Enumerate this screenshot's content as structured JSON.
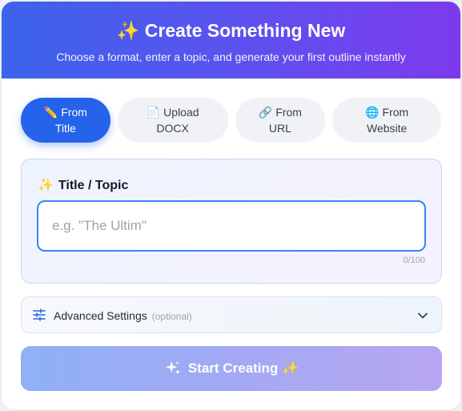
{
  "header": {
    "title": "✨ Create Something New",
    "subtitle": "Choose a format, enter a topic, and generate your first outline instantly"
  },
  "tabs": [
    {
      "icon": "✏️",
      "line1": "From",
      "line2": "Title",
      "active": true
    },
    {
      "icon": "📄",
      "line1": "Upload",
      "line2": "DOCX",
      "active": false
    },
    {
      "icon": "🔗",
      "line1": "From",
      "line2": "URL",
      "active": false
    },
    {
      "icon": "🌐",
      "line1": "From",
      "line2": "Website",
      "active": false
    }
  ],
  "topic": {
    "label_icon": "✨",
    "label": "Title / Topic",
    "placeholder": "e.g. \"The Ultim\"",
    "value": "",
    "counter": "0/100"
  },
  "advanced": {
    "label": "Advanced Settings",
    "optional_text": "(optional)",
    "icon": "sliders-icon",
    "expand_icon": "chevron-down-icon"
  },
  "cta": {
    "icon": "sparkles-icon",
    "label": "Start Creating ✨"
  },
  "colors": {
    "header_start": "#3b63ec",
    "header_end": "#7c3aed",
    "accent": "#2563eb",
    "input_border": "#3b82f6"
  }
}
